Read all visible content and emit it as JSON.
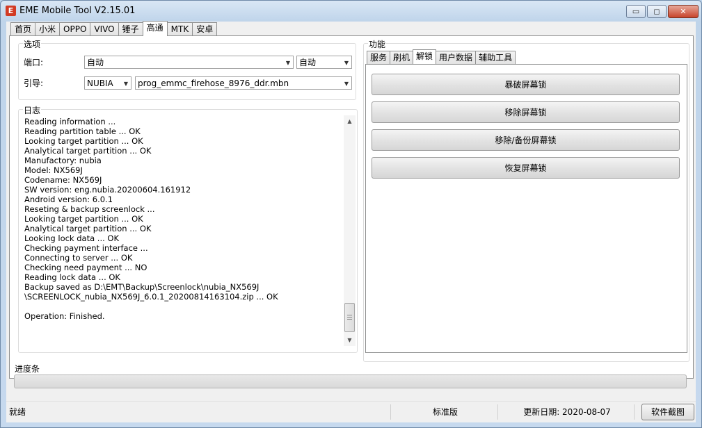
{
  "window": {
    "title": "EME Mobile Tool V2.15.01",
    "app_icon": "E"
  },
  "window_controls": {
    "minimize": "▭",
    "maximize": "◻",
    "close": "✕"
  },
  "main_tabs": [
    {
      "label": "首页",
      "active": false
    },
    {
      "label": "小米",
      "active": false
    },
    {
      "label": "OPPO",
      "active": false
    },
    {
      "label": "VIVO",
      "active": false
    },
    {
      "label": "锤子",
      "active": false
    },
    {
      "label": "高通",
      "active": true
    },
    {
      "label": "MTK",
      "active": false
    },
    {
      "label": "安卓",
      "active": false
    }
  ],
  "options": {
    "group_label": "选项",
    "port_label": "端口:",
    "port_value": "自动",
    "port_mode_value": "自动",
    "boot_label": "引导:",
    "boot_vendor_value": "NUBIA",
    "boot_file_value": "prog_emmc_firehose_8976_ddr.mbn"
  },
  "log": {
    "group_label": "日志",
    "lines": [
      "Reading information ...",
      "Reading partition table ... OK",
      "Looking target partition ... OK",
      "Analytical target partition ... OK",
      "Manufactory: nubia",
      "Model: NX569J",
      "Codename: NX569J",
      "SW version: eng.nubia.20200604.161912",
      "Android version: 6.0.1",
      "Reseting & backup screenlock ...",
      "Looking target partition ... OK",
      "Analytical target partition ... OK",
      "Looking lock data ... OK",
      "Checking payment interface ...",
      "Connecting to server ... OK",
      "Checking need payment ... NO",
      "Reading lock data ... OK",
      "Backup saved as D:\\EMT\\Backup\\Screenlock\\nubia_NX569J",
      "\\SCREENLOCK_nubia_NX569J_6.0.1_20200814163104.zip ... OK",
      "",
      "Operation: Finished."
    ]
  },
  "function": {
    "group_label": "功能",
    "tabs": [
      {
        "label": "服务",
        "active": false
      },
      {
        "label": "刷机",
        "active": false
      },
      {
        "label": "解锁",
        "active": true
      },
      {
        "label": "用户数据",
        "active": false
      },
      {
        "label": "辅助工具",
        "active": false
      }
    ],
    "buttons": [
      "暴破屏幕锁",
      "移除屏幕锁",
      "移除/备份屏幕锁",
      "恢复屏幕锁"
    ]
  },
  "progress": {
    "label": "进度条",
    "value_percent": 0
  },
  "status": {
    "state": "就绪",
    "edition": "标准版",
    "update_date": "更新日期: 2020-08-07",
    "screenshot_button": "软件截图"
  },
  "colors": {
    "accent_red": "#d23b24",
    "progress_green": "#06b025"
  }
}
